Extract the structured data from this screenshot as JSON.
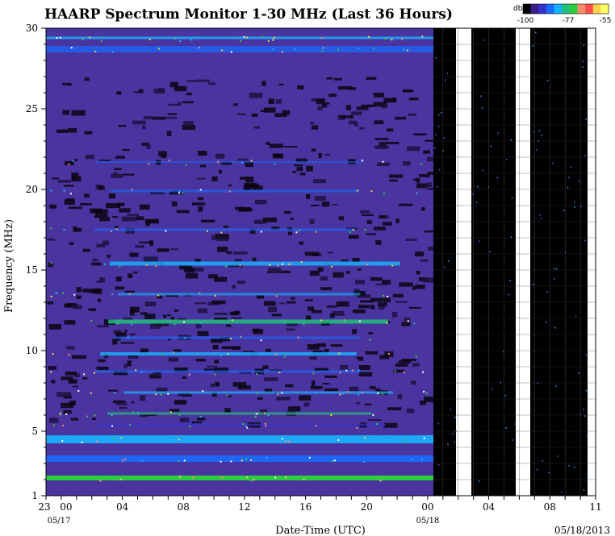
{
  "chart_data": {
    "type": "heatmap",
    "title": "HAARP Spectrum Monitor 1-30 MHz (Last 36 Hours)",
    "xlabel": "Date-Time (UTC)",
    "ylabel": "Frequency (MHz)",
    "date_stamp": "05/18/2013",
    "y_ticks": [
      "1",
      "5",
      "10",
      "15",
      "20",
      "25",
      "30"
    ],
    "ylim": [
      1,
      30
    ],
    "x_ticks": [
      "23",
      "00",
      "04",
      "08",
      "12",
      "16",
      "20",
      "00",
      "04",
      "08",
      "11"
    ],
    "x_date_labels": [
      "05/17",
      "05/18"
    ],
    "colorbar": {
      "unit": "db",
      "tick_labels": [
        "-100",
        "-77",
        "-55"
      ],
      "range": [
        -100,
        -55
      ],
      "colors": [
        "#000000",
        "#3a1f8a",
        "#3333cc",
        "#1a6cff",
        "#19b4ff",
        "#22c07a",
        "#2ecc40",
        "#ff8c69",
        "#ff4d4d",
        "#ffd24d",
        "#ffff66"
      ]
    },
    "no_data_after": "05/18 00:30",
    "missing_intervals": [
      "05/18 01:30-02:30",
      "05/18 06:00-07:00",
      "05/18 10:30-11:00"
    ],
    "active_bands_mhz": [
      2.1,
      3.3,
      4.5,
      5.4,
      6.1,
      7.4,
      8.7,
      9.8,
      10.8,
      11.8,
      13.5,
      15.4,
      17.5,
      19.9,
      21.7,
      28.7,
      29.4
    ]
  }
}
